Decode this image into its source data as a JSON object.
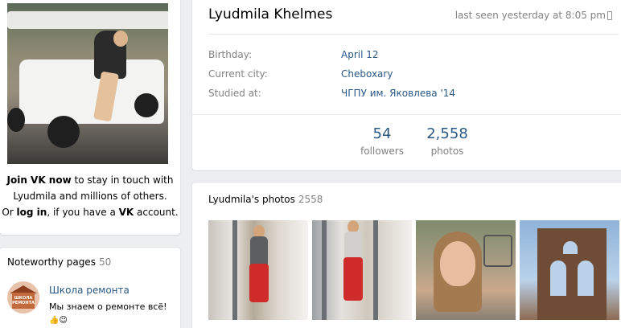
{
  "join": {
    "join_link": "Join VK now",
    "line1_rest": " to stay in touch with",
    "line2": "Lyudmila and millions of others.",
    "or": "Or ",
    "login_link": "log in",
    "line3_mid": ", if you have a ",
    "vk": "VK",
    "line3_end": " account."
  },
  "noteworthy": {
    "title": "Noteworthy pages",
    "count": "50",
    "items": [
      {
        "name": "Школа ремонта",
        "description": "Мы знаем о ремонте всё!",
        "emoji": "👍😉",
        "avatar_text": "ШКОЛА РЕМОНТА"
      }
    ]
  },
  "profile": {
    "name": "Lyudmila Khelmes",
    "last_seen": "last seen yesterday at 8:05 pm",
    "info": [
      {
        "label": "Birthday:",
        "value": "April 12"
      },
      {
        "label": "Current city:",
        "value": "Cheboxary"
      },
      {
        "label": "Studied at:",
        "value": "ЧГПУ им. Яковлева '14"
      }
    ],
    "counters": [
      {
        "value": "54",
        "label": "followers"
      },
      {
        "value": "2,558",
        "label": "photos"
      }
    ]
  },
  "photos": {
    "title": "Lyudmila's photos",
    "count": "2558"
  },
  "colors": {
    "link": "#2a5885",
    "muted": "#828282",
    "background": "#edeef0"
  }
}
